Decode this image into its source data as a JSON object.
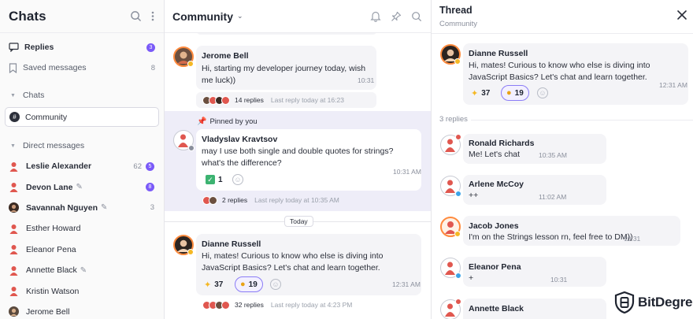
{
  "sidebar": {
    "title": "Chats",
    "nav": [
      {
        "label": "Replies",
        "count": "3",
        "badge": true
      },
      {
        "label": "Saved messages",
        "count": "8",
        "badge": false
      }
    ],
    "chats_section": "Chats",
    "community": "Community",
    "dm_section": "Direct messages",
    "dms": [
      {
        "name": "Leslie Alexander",
        "bold": true,
        "count": "62",
        "badge": "5"
      },
      {
        "name": "Devon Lane",
        "bold": true,
        "count": "",
        "badge": "8",
        "edit": true
      },
      {
        "name": "Savannah Nguyen",
        "bold": true,
        "count": "3",
        "badge": "",
        "edit": true
      },
      {
        "name": "Esther Howard",
        "bold": false,
        "count": "",
        "badge": ""
      },
      {
        "name": "Eleanor Pena",
        "bold": false,
        "count": "",
        "badge": ""
      },
      {
        "name": "Annette Black",
        "bold": false,
        "count": "",
        "badge": "",
        "edit": true
      },
      {
        "name": "Kristin Watson",
        "bold": false,
        "count": "",
        "badge": ""
      },
      {
        "name": "Jerome Bell",
        "bold": false,
        "count": "",
        "badge": ""
      }
    ]
  },
  "channel": {
    "title": "Community",
    "messages": [
      {
        "name": "Jerome Bell",
        "text": "Hi, starting my developer journey today, wish me luck))",
        "time": "10:31",
        "replies": "14 replies",
        "last_reply": "Last reply today at 16:23"
      },
      {
        "pinned_label": "Pinned by you",
        "name": "Vladyslav Kravtsov",
        "text": "may I use both single and double quotes for strings? what's the difference?",
        "time": "10:31 AM",
        "reaction": "1",
        "replies": "2 replies",
        "last_reply": "Last reply today at 10:35 AM"
      },
      {
        "name": "Dianne Russell",
        "text": "Hi, mates! Curious to know who else is diving into JavaScript Basics? Let's chat and learn together.",
        "time": "12:31 AM",
        "reactions": [
          "37",
          "19"
        ],
        "replies": "32 replies",
        "last_reply": "Last reply today at 4:23 PM"
      }
    ],
    "day_separator": "Today"
  },
  "thread": {
    "title": "Thread",
    "subtitle": "Community",
    "root": {
      "name": "Dianne Russell",
      "text": "Hi, mates! Curious to know who else is diving into JavaScript Basics? Let's chat and learn together.",
      "time": "12:31 AM",
      "reactions": [
        "37",
        "19"
      ]
    },
    "replies_count": "3 replies",
    "replies": [
      {
        "name": "Ronald Richards",
        "text": "Me! Let's chat",
        "time": "10:35 AM"
      },
      {
        "name": "Arlene McCoy",
        "text": "++",
        "time": "11:02 AM"
      },
      {
        "name": "Jacob Jones",
        "text": "I'm on the Strings lesson rn, feel free to DM))",
        "time": "10:31"
      },
      {
        "name": "Eleanor Pena",
        "text": "+",
        "time": "10:31"
      },
      {
        "name": "Annette Black",
        "text": "",
        "time": ""
      }
    ]
  },
  "watermark": "BitDegree",
  "colors": {
    "accent": "#7a5af8",
    "pinned_bg": "#eeedf8",
    "bubble_bg": "#f4f4f7",
    "avatar_red": "#e0574f",
    "avatar_orange": "#ff8a3d"
  }
}
